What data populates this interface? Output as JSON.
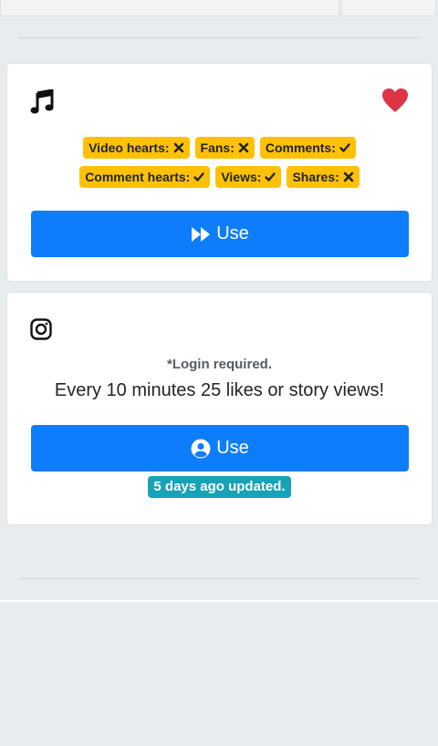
{
  "tiktok_card": {
    "music_icon": "music-note-icon",
    "heart_icon": "heart-icon",
    "heart_color": "#dc3545",
    "badges": [
      {
        "label": "Video hearts:",
        "status": "x"
      },
      {
        "label": "Fans:",
        "status": "x"
      },
      {
        "label": "Comments:",
        "status": "check"
      },
      {
        "label": "Comment hearts:",
        "status": "check"
      },
      {
        "label": "Views:",
        "status": "check"
      },
      {
        "label": "Shares:",
        "status": "x"
      }
    ],
    "use_button": {
      "label": "Use",
      "icon": "fast-forward-icon"
    }
  },
  "instagram_card": {
    "icon": "instagram-icon",
    "login_note": "*Login required.",
    "description": "Every 10 minutes 25 likes or story views!",
    "use_button": {
      "label": "Use",
      "icon": "user-circle-icon"
    },
    "updated_badge": "5 days ago updated."
  },
  "colors": {
    "primary": "#0d7dfb",
    "warning": "#ffc107",
    "info": "#17a2b8",
    "background": "#e9ecef"
  }
}
